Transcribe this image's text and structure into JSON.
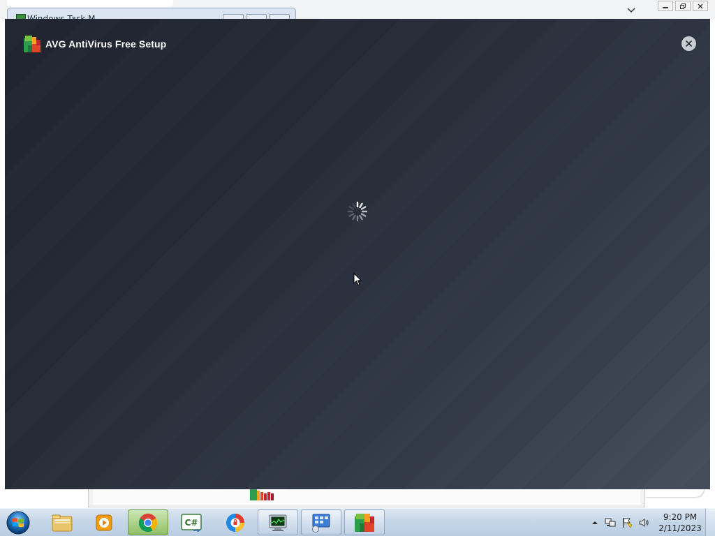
{
  "background": {
    "taskmgr_title": "Windows Task M"
  },
  "setup": {
    "title": "AVG AntiVirus Free Setup",
    "close_icon": "close-icon",
    "status": "loading-spinner-icon",
    "colors": {
      "bg_dark": "#1f2430",
      "bg_light": "#464e5c",
      "title": "#ffffff",
      "close_bg": "#c9cdd3"
    }
  },
  "taskbar": {
    "items": [
      {
        "name": "start-button",
        "icon": "windows-start-icon"
      },
      {
        "name": "file-explorer",
        "icon": "folder-icon"
      },
      {
        "name": "media-player",
        "icon": "media-player-icon"
      },
      {
        "name": "chrome",
        "icon": "chrome-icon"
      },
      {
        "name": "csharp-app",
        "icon": "csharp-icon"
      },
      {
        "name": "avast-secure-browser",
        "icon": "secure-browser-icon"
      },
      {
        "name": "task-manager",
        "icon": "task-manager-icon"
      },
      {
        "name": "remote-desktop",
        "icon": "remote-desktop-icon"
      },
      {
        "name": "avg-setup",
        "icon": "avg-icon"
      }
    ],
    "tray_icons": [
      "show-hidden-icons-icon",
      "network-icon",
      "action-center-flag-icon",
      "volume-icon"
    ],
    "clock": {
      "time": "9:20 PM",
      "date": "2/11/2023"
    }
  }
}
